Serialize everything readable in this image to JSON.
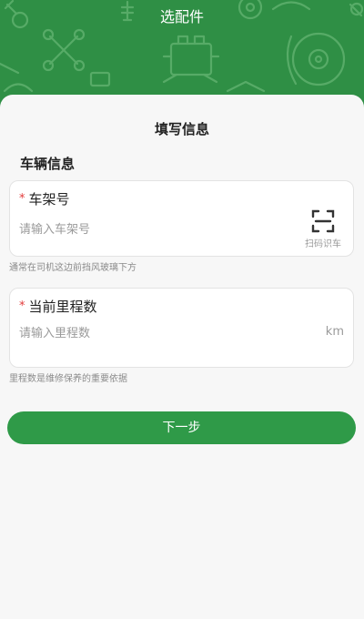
{
  "header": {
    "title": "选配件"
  },
  "form": {
    "title": "填写信息",
    "section_title": "车辆信息",
    "vin": {
      "required_mark": "*",
      "label": "车架号",
      "placeholder": "请输入车架号",
      "scan_label": "扫码识车",
      "hint": "通常在司机这边前挡风玻璃下方"
    },
    "mileage": {
      "required_mark": "*",
      "label": "当前里程数",
      "placeholder": "请输入里程数",
      "unit": "km",
      "hint": "里程数是维修保养的重要依据"
    },
    "next_button": "下一步"
  },
  "icons": {
    "scan": "scan-icon",
    "header_decoration": "auto-parts-decoration-icon"
  },
  "colors": {
    "brand_green": "#2f8f45",
    "button_green": "#2f9a48",
    "required_red": "#e23b3b"
  }
}
